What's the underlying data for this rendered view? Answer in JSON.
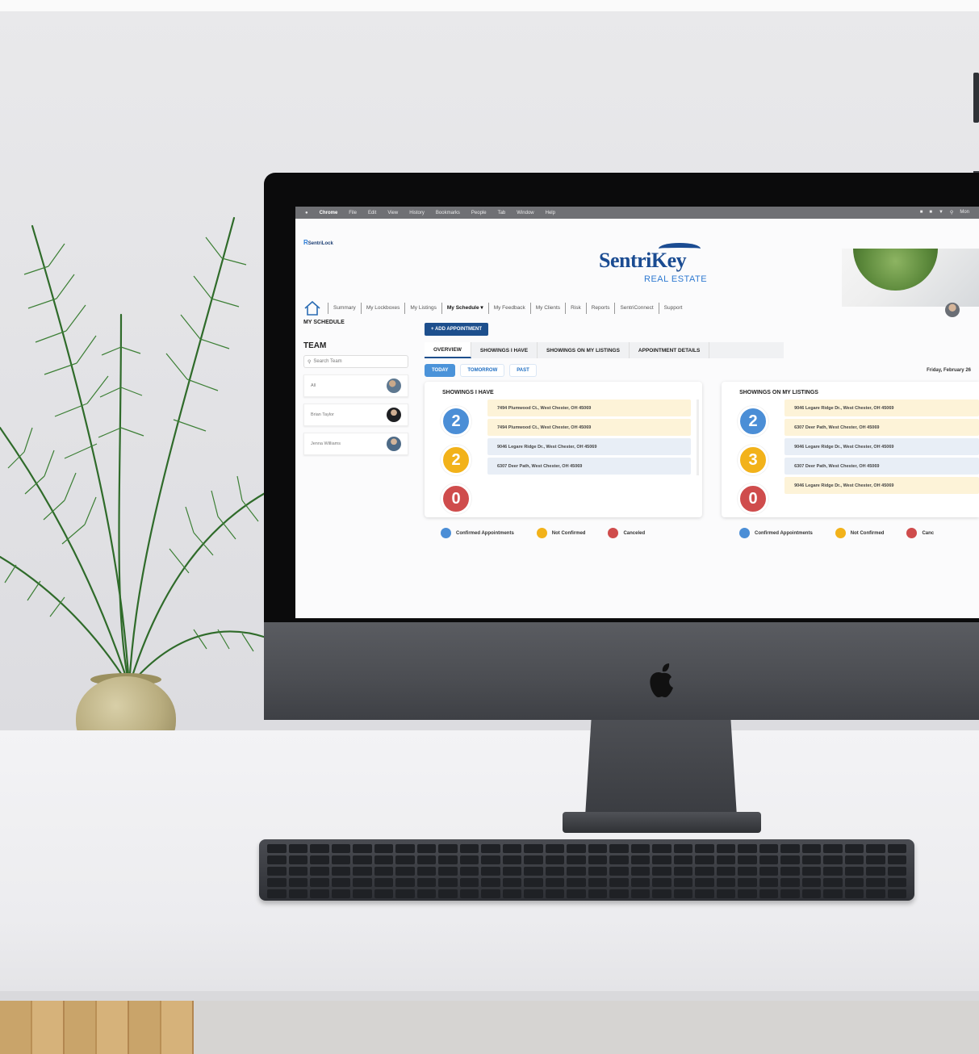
{
  "menubar": {
    "apple": "",
    "items": [
      "Chrome",
      "File",
      "Edit",
      "View",
      "History",
      "Bookmarks",
      "People",
      "Tab",
      "Window",
      "Help"
    ],
    "clock": "Mon"
  },
  "brand": {
    "tiny": "SentriLock",
    "name": "SentriKey",
    "subtitle": "REAL ESTATE"
  },
  "nav": {
    "items": [
      "Summary",
      "My Lockboxes",
      "My Listings",
      "My Schedule ▾",
      "My Feedback",
      "My Clients",
      "Risk",
      "Reports",
      "SentriConnect",
      "Support"
    ]
  },
  "sidebar": {
    "title": "MY SCHEDULE",
    "team_title": "TEAM",
    "search_placeholder": "Search Team",
    "members": [
      "All",
      "Brian Taylor",
      "Jenna Williams"
    ]
  },
  "main": {
    "add_button": "+ ADD APPOINTMENT",
    "tabs": [
      "OVERVIEW",
      "SHOWINGS I HAVE",
      "SHOWINGS ON MY LISTINGS",
      "APPOINTMENT DETAILS"
    ],
    "filters": [
      "TODAY",
      "TOMORROW",
      "PAST"
    ],
    "date": "Friday, February 26"
  },
  "cards": [
    {
      "title": "SHOWINGS I HAVE",
      "counts": [
        "2",
        "2",
        "0"
      ],
      "rows": [
        {
          "text": "7494 Plumwood Ct., West Chester, OH 45069",
          "status": "yellow"
        },
        {
          "text": "7494 Plumwood Ct., West Chester, OH 45069",
          "status": "yellow"
        },
        {
          "text": "9046 Legare Ridge Dr., West Chester, OH 45069",
          "status": "blue"
        },
        {
          "text": "6307 Deer Path, West Chester, OH 45069",
          "status": "blue"
        }
      ]
    },
    {
      "title": "SHOWINGS ON MY LISTINGS",
      "counts": [
        "2",
        "3",
        "0"
      ],
      "rows": [
        {
          "text": "9046 Legare Ridge Dr., West Chester, OH 45069",
          "status": "yellow"
        },
        {
          "text": "6307 Deer Path, West Chester, OH 45069",
          "status": "yellow"
        },
        {
          "text": "9046 Legare Ridge Dr., West Chester, OH 45069",
          "status": "blue"
        },
        {
          "text": "6307 Deer Path, West Chester, OH 45069",
          "status": "blue"
        },
        {
          "text": "9046 Legare Ridge Dr., West Chester, OH 45069",
          "status": "yellow"
        }
      ]
    }
  ],
  "legend": {
    "confirmed": "Confirmed Appointments",
    "not_confirmed": "Not Confirmed",
    "canceled": "Canceled",
    "canceled_cut": "Canc"
  },
  "colors": {
    "brand_blue": "#1b4c92",
    "confirmed": "#4b8ed6",
    "not_confirmed": "#f2b21a",
    "canceled": "#cf4c4c"
  }
}
